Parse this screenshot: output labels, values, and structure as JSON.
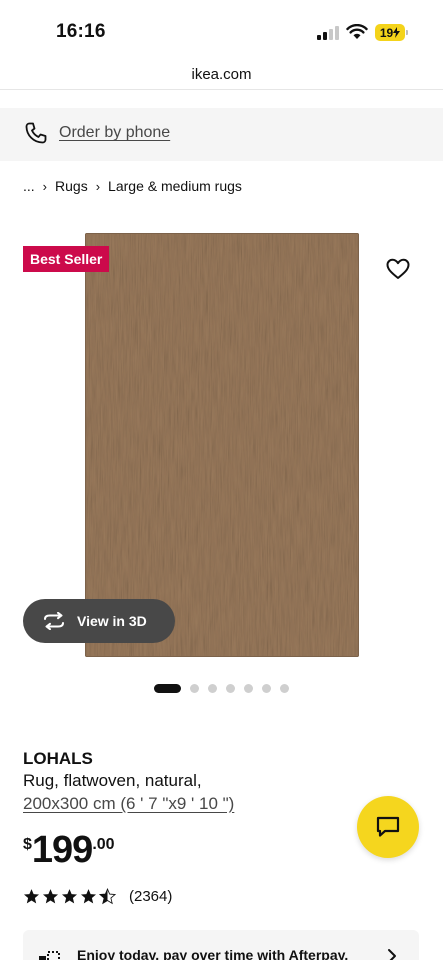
{
  "status_bar": {
    "time": "16:16",
    "battery": "19"
  },
  "browser": {
    "url": "ikea.com"
  },
  "order_bar": {
    "label": "Order by phone"
  },
  "breadcrumb": {
    "ellipsis": "...",
    "items": [
      "Rugs",
      "Large & medium rugs"
    ]
  },
  "gallery": {
    "badge": "Best Seller",
    "view_3d_label": "View in 3D",
    "image_count": 7,
    "active_index": 0
  },
  "product": {
    "name": "LOHALS",
    "description": "Rug, flatwoven, natural,",
    "size": "200x300 cm (6 ' 7 \"x9 ' 10 \")",
    "price_currency": "$",
    "price_integer": "199",
    "price_decimal": ".00",
    "rating": 4.5,
    "review_count": "(2364)"
  },
  "afterpay": {
    "text": "Enjoy today, pay over time with Afterpay."
  },
  "colors": {
    "badge": "#cc0a4b",
    "chat": "#f5d61e",
    "battery": "#f4d31a"
  }
}
